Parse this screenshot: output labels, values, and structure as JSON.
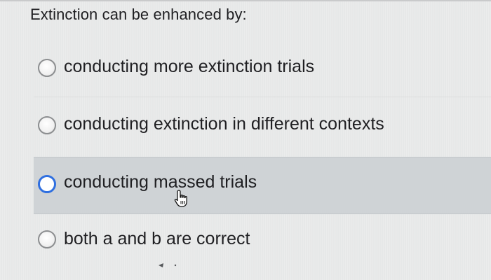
{
  "question": {
    "text": "Extinction can be enhanced by:"
  },
  "options": [
    {
      "label": "conducting more extinction trials",
      "selected": false,
      "hovered": false
    },
    {
      "label": "conducting extinction in different contexts",
      "selected": false,
      "hovered": false
    },
    {
      "label": "conducting massed trials",
      "selected": false,
      "hovered": true
    },
    {
      "label": "both a and b are correct",
      "selected": false,
      "hovered": false
    }
  ],
  "cursor": {
    "icon": "hand-pointer-icon"
  },
  "colors": {
    "background": "#e9eaea",
    "hover_row": "#cfd3d6",
    "focus_ring": "#2f6fe0",
    "text": "#1f1f22"
  }
}
